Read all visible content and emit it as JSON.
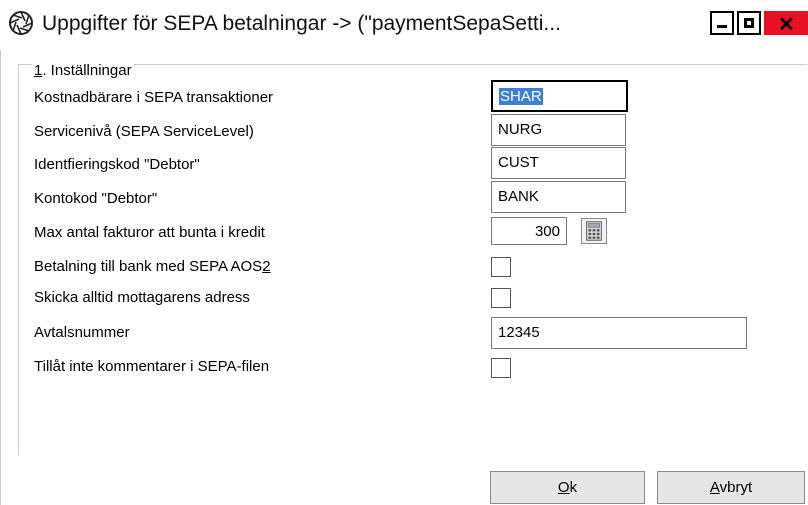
{
  "window": {
    "title": "Uppgifter för SEPA betalningar    -> (\"paymentSepaSetti...",
    "icon": "aperture-icon",
    "close_glyph": "✕"
  },
  "group": {
    "legend_mnemonic": "1",
    "legend_rest": ". Inställningar"
  },
  "fields": {
    "cost_bearer": {
      "label": "Kostnadbärare i SEPA transaktioner",
      "value": "SHAR"
    },
    "service_level": {
      "label": "Servicenivå (SEPA ServiceLevel)",
      "value": "NURG"
    },
    "debtor_id_code": {
      "label": "Identfieringskod \"Debtor\"",
      "value": "CUST"
    },
    "debtor_account_code": {
      "label": "Kontokod \"Debtor\"",
      "value": "BANK"
    },
    "max_invoices": {
      "label": "Max antal fakturor att bunta i kredit",
      "value": "300"
    },
    "aos2": {
      "label_main": "Betalning till bank med SEPA AOS",
      "label_mnemonic": "2",
      "checked": false
    },
    "always_send_address": {
      "label": "Skicka alltid mottagarens adress",
      "checked": false
    },
    "agreement_number": {
      "label": "Avtalsnummer",
      "value": "12345"
    },
    "no_comments": {
      "label": "Tillåt inte kommentarer i SEPA-filen",
      "checked": false
    }
  },
  "buttons": {
    "ok": {
      "mnemonic": "O",
      "rest": "k"
    },
    "cancel": {
      "mnemonic": "A",
      "rest": "vbryt"
    }
  },
  "colors": {
    "selection": "#3b7fd6",
    "close_button": "#e81123"
  }
}
